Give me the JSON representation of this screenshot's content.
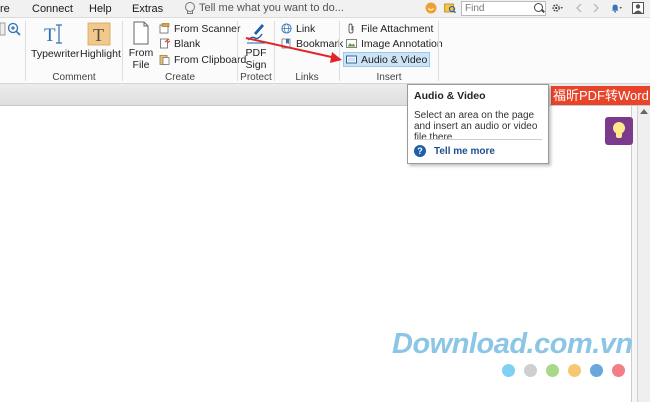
{
  "menu": {
    "items": [
      "re",
      "Connect",
      "Help",
      "Extras"
    ],
    "tell_me_placeholder": "Tell me what you want to do...",
    "find_placeholder": "Find"
  },
  "ribbon": {
    "comment": {
      "label": "Comment",
      "typewriter": "Typewriter",
      "highlight": "Highlight"
    },
    "create": {
      "label": "Create",
      "from_file_line1": "From",
      "from_file_line2": "File",
      "from_scanner": "From Scanner",
      "blank": "Blank",
      "from_clipboard": "From Clipboard"
    },
    "protect": {
      "label": "Protect",
      "pdf_sign_line1": "PDF",
      "pdf_sign_line2": "Sign"
    },
    "links": {
      "label": "Links",
      "link": "Link",
      "bookmark": "Bookmark"
    },
    "insert": {
      "label": "Insert",
      "file_attachment": "File Attachment",
      "image_annotation": "Image Annotation",
      "audio_video": "Audio & Video"
    }
  },
  "banner_text": "福昕PDF转Word",
  "tooltip": {
    "title": "Audio & Video",
    "description": "Select an area on the page and insert an audio or video file there",
    "tell_me_more": "Tell me more"
  },
  "watermark": {
    "text": "Download.com.vn",
    "dot_colors": [
      "#7fd0f2",
      "#cfcfcf",
      "#a8d98a",
      "#f7c873",
      "#6aa7dd",
      "#f27f86"
    ]
  },
  "colors": {
    "arrow": "#e0262a",
    "highlight_fill": "#f2c98d",
    "bulb_button": "#7b3a8c",
    "banner": "#e8442a"
  }
}
